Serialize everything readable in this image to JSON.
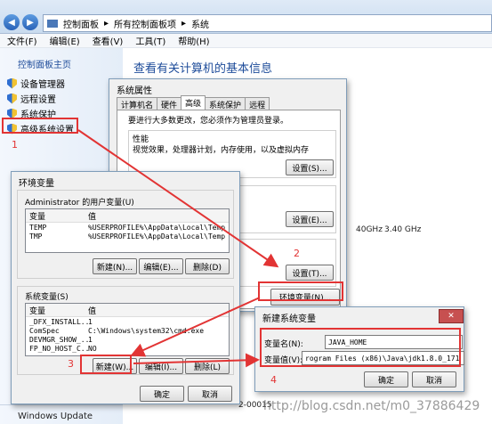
{
  "breadcrumb": [
    "控制面板",
    "所有控制面板项",
    "系统"
  ],
  "menubar": [
    "文件(F)",
    "编辑(E)",
    "查看(V)",
    "工具(T)",
    "帮助(H)"
  ],
  "sidebar": {
    "home": "控制面板主页",
    "items": [
      "设备管理器",
      "远程设置",
      "系统保护",
      "高级系统设置"
    ]
  },
  "main": {
    "heading": "查看有关计算机的基本信息",
    "cpu_speed_a": "40GHz",
    "cpu_speed_b": "3.40 GHz",
    "product_id_fragment": "2-00015",
    "windows_update": "Windows Update"
  },
  "sysprops": {
    "title": "系统属性",
    "tabs": [
      "计算机名",
      "硬件",
      "高级",
      "系统保护",
      "远程"
    ],
    "admin_note": "要进行大多数更改，您必须作为管理员登录。",
    "perf_title": "性能",
    "perf_desc": "视觉效果，处理器计划，内存使用，以及虚拟内存",
    "settings_btn": "设置(S)...",
    "settings_btn2": "设置(E)...",
    "settings_btn3": "设置(T)...",
    "envvars_btn": "环境变量(N)..."
  },
  "envvars": {
    "title": "环境变量",
    "user_group": "Administrator 的用户变量(U)",
    "col_var": "变量",
    "col_val": "值",
    "user_vars": [
      {
        "name": "TEMP",
        "value": "%USERPROFILE%\\AppData\\Local\\Temp"
      },
      {
        "name": "TMP",
        "value": "%USERPROFILE%\\AppData\\Local\\Temp"
      }
    ],
    "new_btn": "新建(N)...",
    "edit_btn": "编辑(E)...",
    "delete_btn": "删除(D)",
    "sys_group": "系统变量(S)",
    "sys_vars": [
      {
        "name": "_DFX_INSTALL...",
        "value": "1"
      },
      {
        "name": "ComSpec",
        "value": "C:\\Windows\\system32\\cmd.exe"
      },
      {
        "name": "DEVMGR_SHOW_...",
        "value": "1"
      },
      {
        "name": "FP_NO_HOST_C...",
        "value": "NO"
      }
    ],
    "sys_new_btn": "新建(W)...",
    "sys_edit_btn": "编辑(I)...",
    "sys_delete_btn": "删除(L)",
    "ok_btn": "确定",
    "cancel_btn": "取消"
  },
  "newvar": {
    "title": "新建系统变量",
    "name_label": "变量名(N):",
    "name_value": "JAVA_HOME",
    "value_label": "变量值(V):",
    "value_value": "rogram Files (x86)\\Java\\jdk1.8.0_171",
    "ok_btn": "确定",
    "cancel_btn": "取消"
  },
  "annotations": {
    "step1": "1",
    "step2": "2",
    "step3": "3",
    "step4": "4"
  },
  "watermark": "http://blog.csdn.net/m0_37886429",
  "colors": {
    "annotation_red": "#e23434",
    "link_blue": "#1e4c9a"
  }
}
